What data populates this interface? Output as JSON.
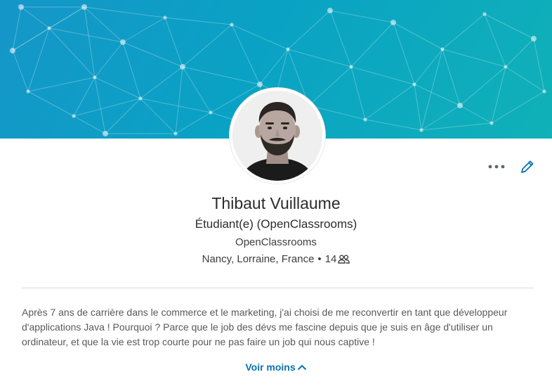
{
  "profile": {
    "name": "Thibaut Vuillaume",
    "headline": "Étudiant(e) (OpenClassrooms)",
    "company": "OpenClassrooms",
    "location": "Nancy, Lorraine, France",
    "separator": "•",
    "connections": "14"
  },
  "summary": {
    "text": "Après 7 ans de carrière dans le commerce et le marketing, j'ai choisi de me reconvertir en tant que développeur d'applications Java ! Pourquoi ? Parce que le job des dévs me fascine depuis que je suis en âge d'utiliser un ordinateur, et que la vie est trop courte pour ne pas faire un job qui nous captive !",
    "toggle_label": "Voir moins"
  },
  "actions": {
    "more_icon": "more-horizontal-icon",
    "edit_icon": "pencil-icon"
  },
  "colors": {
    "banner_start": "#1596c8",
    "banner_end": "#10b1b8",
    "link": "#0a72b0",
    "text_primary": "#2b2b2b",
    "text_secondary": "#595959"
  }
}
